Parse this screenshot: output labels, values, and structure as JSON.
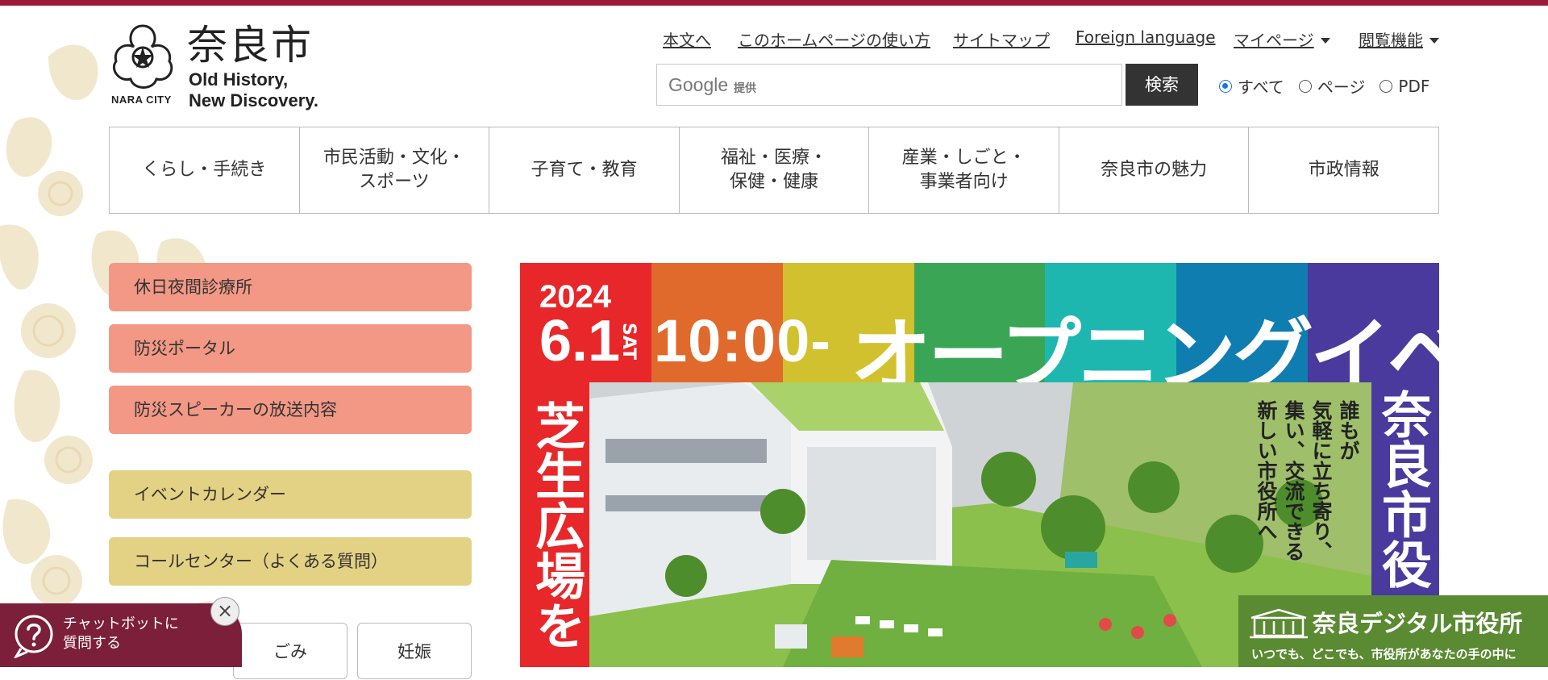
{
  "header": {
    "logo": {
      "title_jp": "奈良市",
      "city_en": "NARA CITY",
      "tagline_line1": "Old History,",
      "tagline_line2": "New Discovery."
    },
    "util_links": [
      {
        "label": "本文へ"
      },
      {
        "label": "このホームページの使い方"
      },
      {
        "label": "サイトマップ"
      },
      {
        "label": "Foreign language"
      },
      {
        "label": "マイページ"
      },
      {
        "label": "閲覧機能"
      }
    ],
    "search": {
      "brand": "Google",
      "brand_sub": "提供",
      "button_label": "検索",
      "scope_options": [
        {
          "label": "すべて",
          "selected": true
        },
        {
          "label": "ページ",
          "selected": false
        },
        {
          "label": "PDF",
          "selected": false
        }
      ]
    }
  },
  "main_nav": [
    {
      "label": "くらし・手続き"
    },
    {
      "label": "市民活動・文化・\nスポーツ"
    },
    {
      "label": "子育て・教育"
    },
    {
      "label": "福祉・医療・\n保健・健康"
    },
    {
      "label": "産業・しごと・\n事業者向け"
    },
    {
      "label": "奈良市の魅力"
    },
    {
      "label": "市政情報"
    }
  ],
  "side_links": {
    "emergency": [
      {
        "label": "休日夜間診療所"
      },
      {
        "label": "防災ポータル"
      },
      {
        "label": "防災スピーカーの放送内容"
      }
    ],
    "info": [
      {
        "label": "イベントカレンダー"
      },
      {
        "label": "コールセンター（よくある質問）"
      }
    ],
    "cards": [
      {
        "label": "ごみ"
      },
      {
        "label": "妊娠"
      }
    ]
  },
  "chatbot": {
    "line1": "チャットボットに",
    "line2": "質問する",
    "close": "×"
  },
  "banner": {
    "year": "2024",
    "date": "6.1",
    "weekday": "SAT",
    "time": "10:00-",
    "title": "オープニングイベント",
    "left_vertical": "芝生広場を",
    "right_vertical": "奈良市役",
    "copy_lines": [
      "誰もが",
      "気軽に立ち寄り、",
      "集い、交流できる",
      "新しい市役所へ"
    ],
    "colors": [
      "#e8272a",
      "#e06a2c",
      "#d2c12f",
      "#3aa655",
      "#1db7b0",
      "#0f7db0",
      "#4a3a9e"
    ]
  },
  "digital_city_hall": {
    "title": "奈良デジタル市役所",
    "subtitle": "いつでも、どこでも、市役所があなたの手の中に"
  },
  "colors": {
    "top_bar": "#9b1b3a",
    "salmon": "#f29885",
    "yellow": "#e3d283",
    "chatbot": "#7b1f3a",
    "dch": "#5a8a32",
    "search_button": "#333333"
  }
}
